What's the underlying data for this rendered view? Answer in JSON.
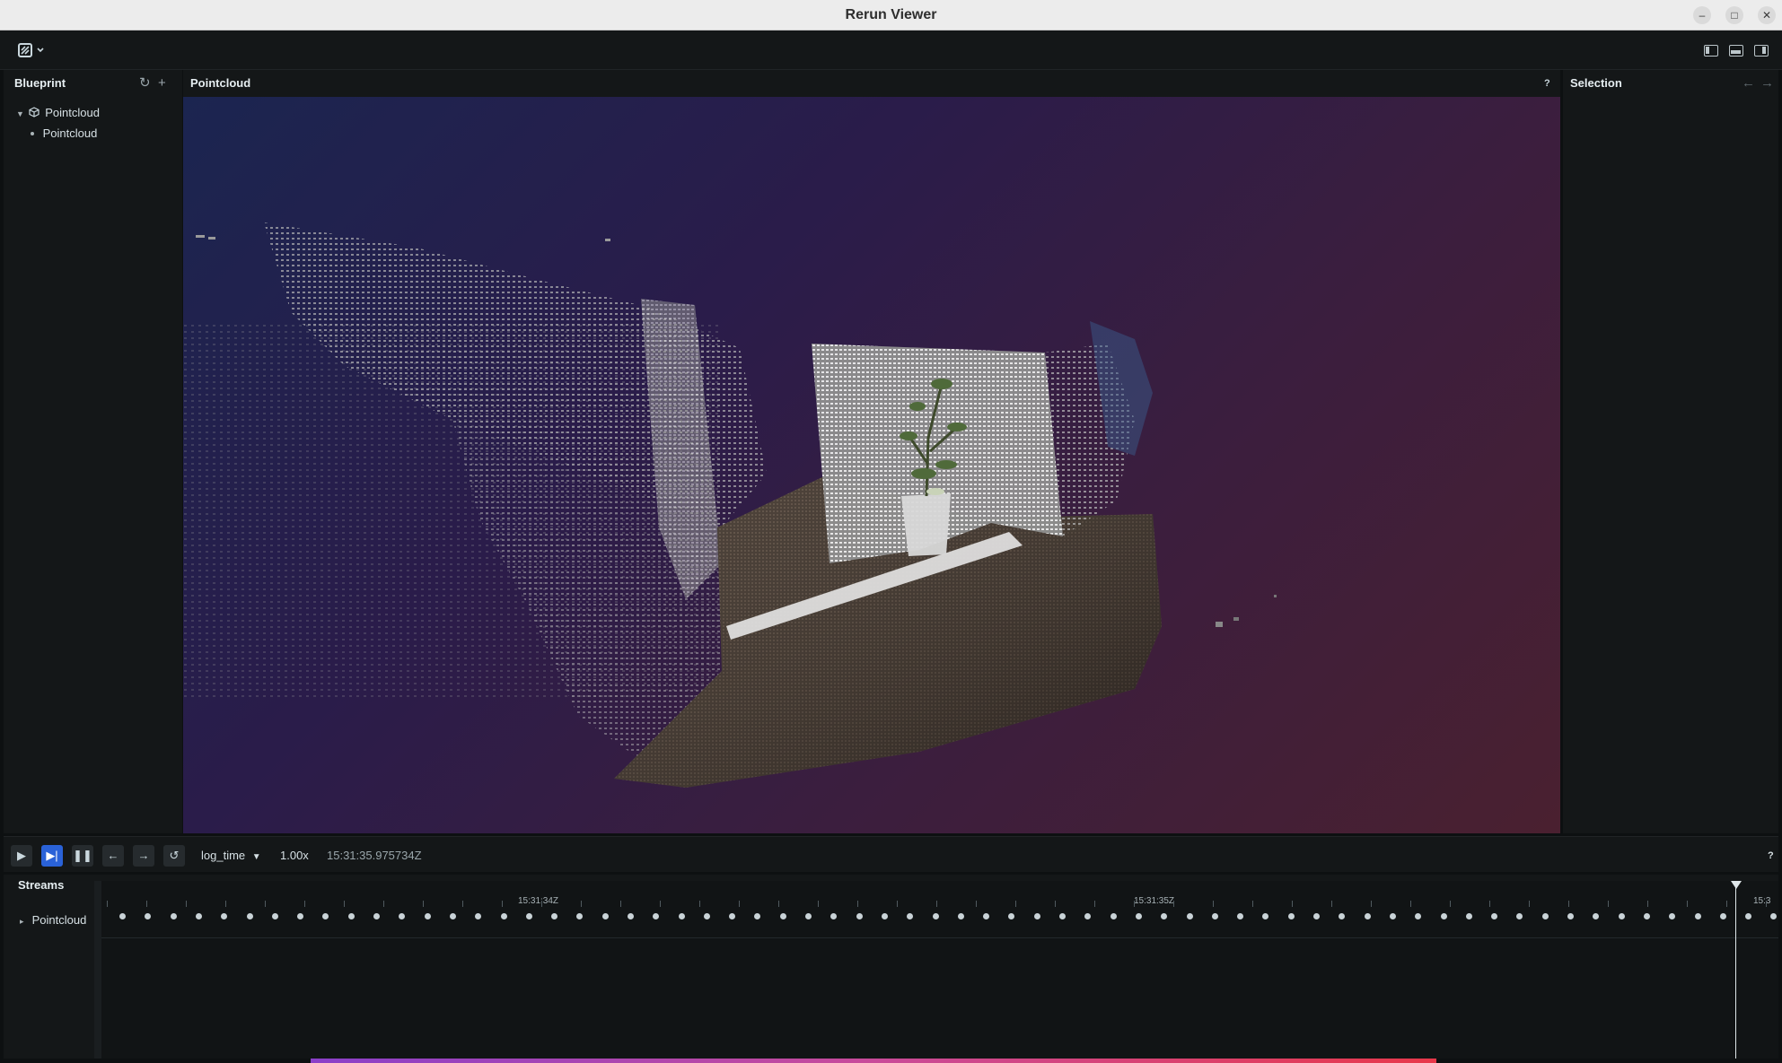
{
  "window": {
    "title": "Rerun Viewer"
  },
  "blueprint": {
    "title": "Blueprint",
    "tree": [
      {
        "label": "Pointcloud",
        "kind": "space-view"
      },
      {
        "label": "Pointcloud",
        "kind": "entity"
      }
    ]
  },
  "viewport": {
    "title": "Pointcloud",
    "help": "?",
    "scene": "3D point cloud of a room corner with a potted plant",
    "background_colors": [
      "#1b2550",
      "#4a2030"
    ]
  },
  "selection": {
    "title": "Selection"
  },
  "time_panel": {
    "timeline": "log_time",
    "speed": "1.00x",
    "current_time": "15:31:35.975734Z",
    "help": "?"
  },
  "streams": {
    "title": "Streams",
    "rows": [
      {
        "label": "Pointcloud"
      }
    ],
    "ruler_labels": [
      "15:31:34Z",
      "15:31:35Z",
      "15:3"
    ]
  },
  "icons": [
    "rerun-logo-icon",
    "reset-icon",
    "add-icon",
    "help-icon",
    "back-arrow-icon",
    "forward-arrow-icon",
    "play-icon",
    "follow-icon",
    "pause-icon",
    "step-back-icon",
    "step-forward-icon",
    "loop-icon",
    "chevron-down-icon"
  ]
}
